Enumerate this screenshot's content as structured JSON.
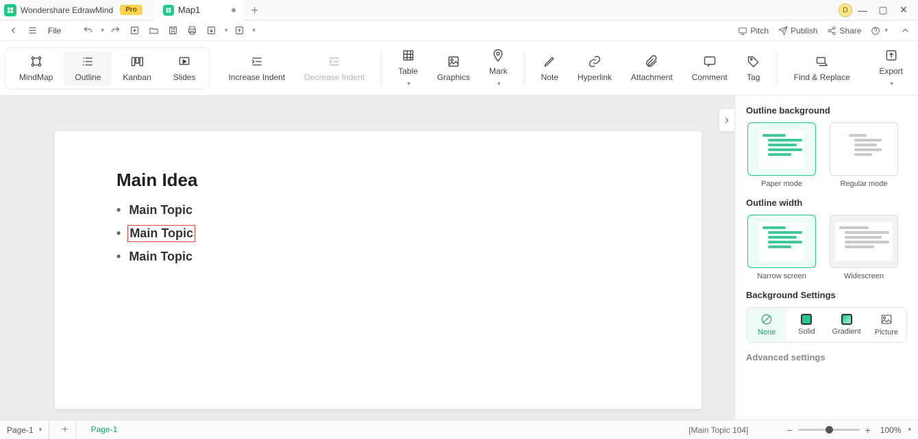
{
  "titlebar": {
    "app_name": "Wondershare EdrawMind",
    "pro_badge": "Pro",
    "doc_name": "Map1",
    "user_initial": "D"
  },
  "quickbar": {
    "file": "File",
    "pitch": "Pitch",
    "publish": "Publish",
    "share": "Share"
  },
  "ribbon": {
    "mindmap": "MindMap",
    "outline": "Outline",
    "kanban": "Kanban",
    "slides": "Slides",
    "increase_indent": "Increase Indent",
    "decrease_indent": "Decrease Indent",
    "table": "Table",
    "graphics": "Graphics",
    "mark": "Mark",
    "note": "Note",
    "hyperlink": "Hyperlink",
    "attachment": "Attachment",
    "comment": "Comment",
    "tag": "Tag",
    "find_replace": "Find & Replace",
    "export": "Export"
  },
  "outline": {
    "main_idea": "Main Idea",
    "topics": [
      "Main Topic",
      "Main Topic",
      "Main Topic"
    ],
    "selected_index": 1
  },
  "sidepanel": {
    "bg_title": "Outline background",
    "paper_mode": "Paper mode",
    "regular_mode": "Regular mode",
    "width_title": "Outline width",
    "narrow": "Narrow screen",
    "wide": "Widescreen",
    "bg_settings_title": "Background Settings",
    "none": "None",
    "solid": "Solid",
    "gradient": "Gradient",
    "picture": "Picture",
    "advanced": "Advanced settings"
  },
  "statusbar": {
    "page_select": "Page-1",
    "page_tab": "Page-1",
    "selection": "[Main Topic 104]",
    "zoom": "100%"
  }
}
